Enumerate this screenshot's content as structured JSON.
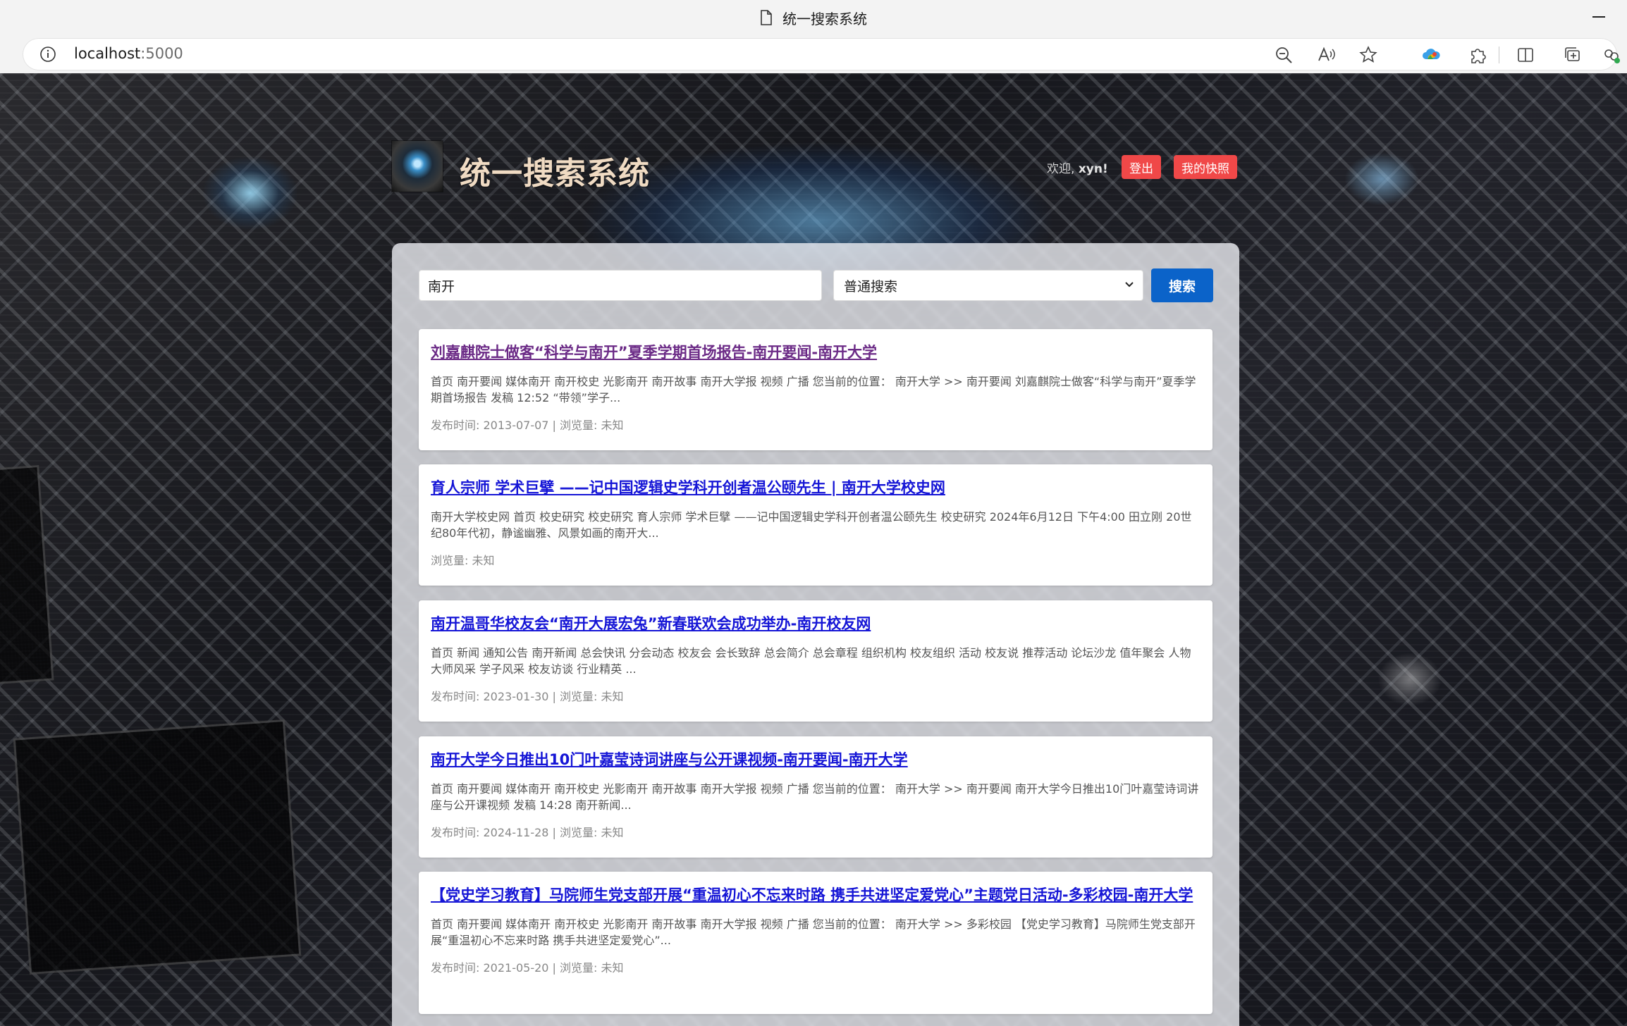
{
  "browser": {
    "tab_title": "统一搜索系统",
    "url_host": "localhost",
    "url_port": ":5000"
  },
  "header": {
    "site_title": "统一搜索系统",
    "welcome_prefix": "欢迎, ",
    "username": "xyn!",
    "logout_label": "登出",
    "snapshot_label": "我的快照"
  },
  "search": {
    "query": "南开",
    "mode_selected": "普通搜索",
    "button_label": "搜索"
  },
  "results": [
    {
      "title": "刘嘉麒院士做客“科学与南开”夏季学期首场报告-南开要闻-南开大学",
      "snippet": "首页 南开要闻 媒体南开 南开校史 光影南开 南开故事 南开大学报 视频 广播 您当前的位置： 南开大学 >> 南开要闻 刘嘉麒院士做客“科学与南开”夏季学期首场报告 发稿 12:52 “带领”学子...",
      "meta": "发布时间: 2013-07-07 | 浏览量: 未知",
      "visited": true
    },
    {
      "title": "育人宗师 学术巨擘 ——记中国逻辑史学科开创者温公颐先生 | 南开大学校史网",
      "snippet": "南开大学校史网 首页 校史研究 校史研究 育人宗师 学术巨擘 ——记中国逻辑史学科开创者温公颐先生 校史研究 2024年6月12日 下午4:00 田立刚 20世纪80年代初，静谧幽雅、风景如画的南开大...",
      "meta": "浏览量: 未知",
      "visited": false
    },
    {
      "title": "南开温哥华校友会“南开大展宏兔”新春联欢会成功举办-南开校友网",
      "snippet": "首页 新闻 通知公告 南开新闻 总会快讯 分会动态 校友会 会长致辞 总会简介 总会章程 组织机构 校友组织 活动 校友说 推荐活动 论坛沙龙 值年聚会 人物 大师风采 学子风采 校友访谈 行业精英 ...",
      "meta": "发布时间: 2023-01-30 | 浏览量: 未知",
      "visited": false
    },
    {
      "title": "南开大学今日推出10门叶嘉莹诗词讲座与公开课视频-南开要闻-南开大学",
      "snippet": "首页 南开要闻 媒体南开 南开校史 光影南开 南开故事 南开大学报 视频 广播 您当前的位置： 南开大学 >> 南开要闻 南开大学今日推出10门叶嘉莹诗词讲座与公开课视频 发稿 14:28 南开新闻...",
      "meta": "发布时间: 2024-11-28 | 浏览量: 未知",
      "visited": false
    },
    {
      "title": "【党史学习教育】马院师生党支部开展“重温初心不忘来时路 携手共进坚定爱党心”主题党日活动-多彩校园-南开大学",
      "snippet": "首页 南开要闻 媒体南开 南开校史 光影南开 南开故事 南开大学报 视频 广播 您当前的位置： 南开大学 >> 多彩校园 【党史学习教育】马院师生党支部开展“重温初心不忘来时路 携手共进坚定爱党心”...",
      "meta": "发布时间: 2021-05-20 | 浏览量: 未知",
      "visited": false
    }
  ]
}
